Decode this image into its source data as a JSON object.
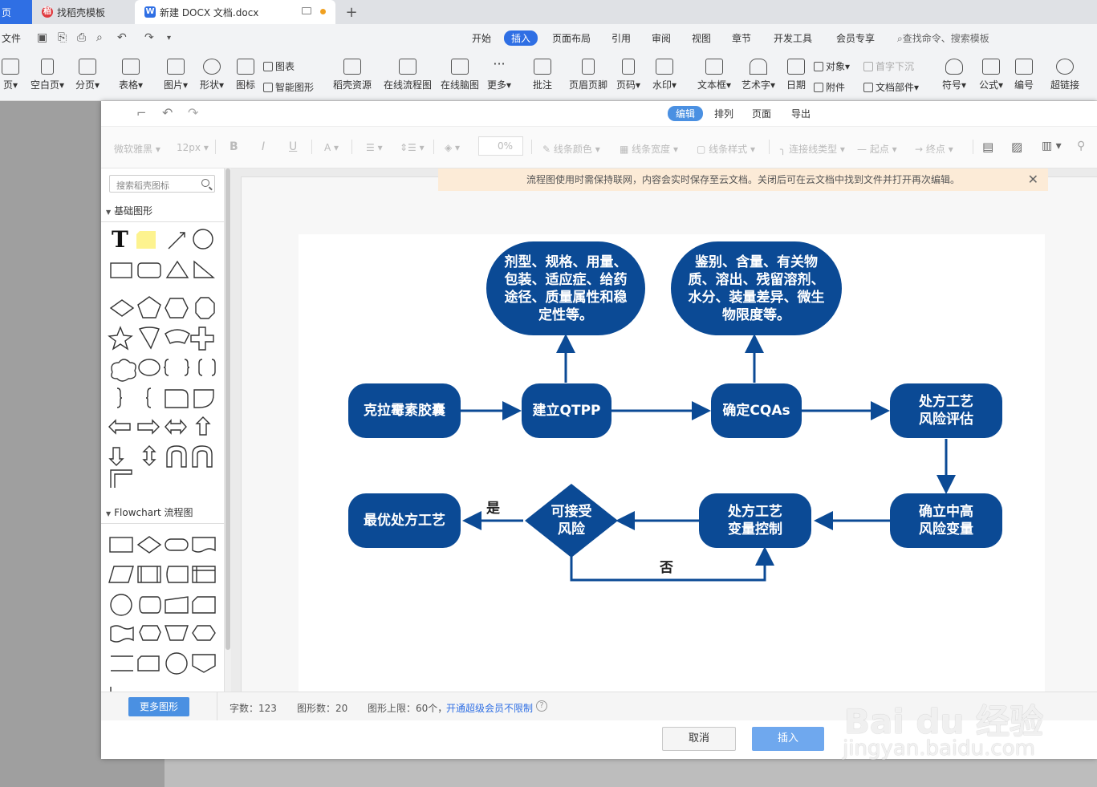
{
  "tabs": {
    "home": "页",
    "docer": "找稻壳模板",
    "doc": "新建 DOCX 文档.docx"
  },
  "menu": {
    "file": "文件",
    "items": [
      "开始",
      "插入",
      "页面布局",
      "引用",
      "审阅",
      "视图",
      "章节",
      "开发工具",
      "会员专享"
    ],
    "active": "插入",
    "search": "查找命令、搜索模板"
  },
  "ribbon": {
    "page": "页▾",
    "blank_page": "空白页▾",
    "page_break": "分页▾",
    "table": "表格▾",
    "picture": "图片▾",
    "shape": "形状▾",
    "icon": "图标",
    "chart": "图表",
    "smart_graphic": "智能图形",
    "docer_resource": "稻壳资源",
    "online_flowchart": "在线流程图",
    "online_mindmap": "在线脑图",
    "more": "更多▾",
    "comment": "批注",
    "header_footer": "页眉页脚",
    "page_number": "页码▾",
    "watermark": "水印▾",
    "textbox": "文本框▾",
    "wordart": "艺术字▾",
    "date": "日期",
    "object": "对象▾",
    "attachment": "附件",
    "drop_cap": "首字下沉",
    "doc_parts": "文档部件▾",
    "symbol": "符号▾",
    "formula": "公式▾",
    "numbering": "编号",
    "hyperlink": "超链接"
  },
  "dialog": {
    "tabs": [
      "编辑",
      "排列",
      "页面",
      "导出"
    ],
    "active_tab": "编辑",
    "format": {
      "font": "微软雅黑",
      "size": "12px",
      "bold": "B",
      "italic": "I",
      "underline": "U",
      "font_color": "A",
      "opacity": "0%",
      "line_color": "线条颜色",
      "line_width": "线条宽度",
      "line_style": "线条样式",
      "connector": "连接线类型",
      "start": "起点",
      "end": "终点"
    },
    "search_placeholder": "搜索稻壳图标",
    "sections": {
      "basic": "基础图形",
      "flowchart": "Flowchart 流程图"
    },
    "notice": "流程图使用时需保持联网，内容会实时保存至云文档。关闭后可在云文档中找到文件并打开再次编辑。",
    "status": {
      "more_shapes": "更多图形",
      "char_count": "字数：123",
      "shape_count": "图形数：20",
      "shape_limit": "图形上限：60个，",
      "upgrade_link": "开通超级会员不限制"
    },
    "buttons": {
      "cancel": "取消",
      "insert": "插入"
    }
  },
  "flowchart": {
    "nodes": {
      "capsule": "克拉霉素胶囊",
      "qtpp": "建立QTPP",
      "cqas": "确定CQAs",
      "risk_assess_1": "处方工艺",
      "risk_assess_2": "风险评估",
      "highrisk_1": "确立中高",
      "highrisk_2": "风险变量",
      "control_1": "处方工艺",
      "control_2": "变量控制",
      "accept_1": "可接受",
      "accept_2": "风险",
      "optimal": "最优处方工艺",
      "qtpp_detail": [
        "剂型、规格、用量、",
        "包装、适应症、给药",
        "途径、质量属性和稳",
        "定性等。"
      ],
      "cqas_detail": [
        "鉴别、含量、有关物",
        "质、溶出、残留溶剂、",
        "水分、装量差异、微生",
        "物限度等。"
      ]
    },
    "labels": {
      "yes": "是",
      "no": "否"
    },
    "color": "#0b4a95"
  },
  "watermark": {
    "brand": "Bai du 经验",
    "url": "jingyan.baidu.com"
  }
}
